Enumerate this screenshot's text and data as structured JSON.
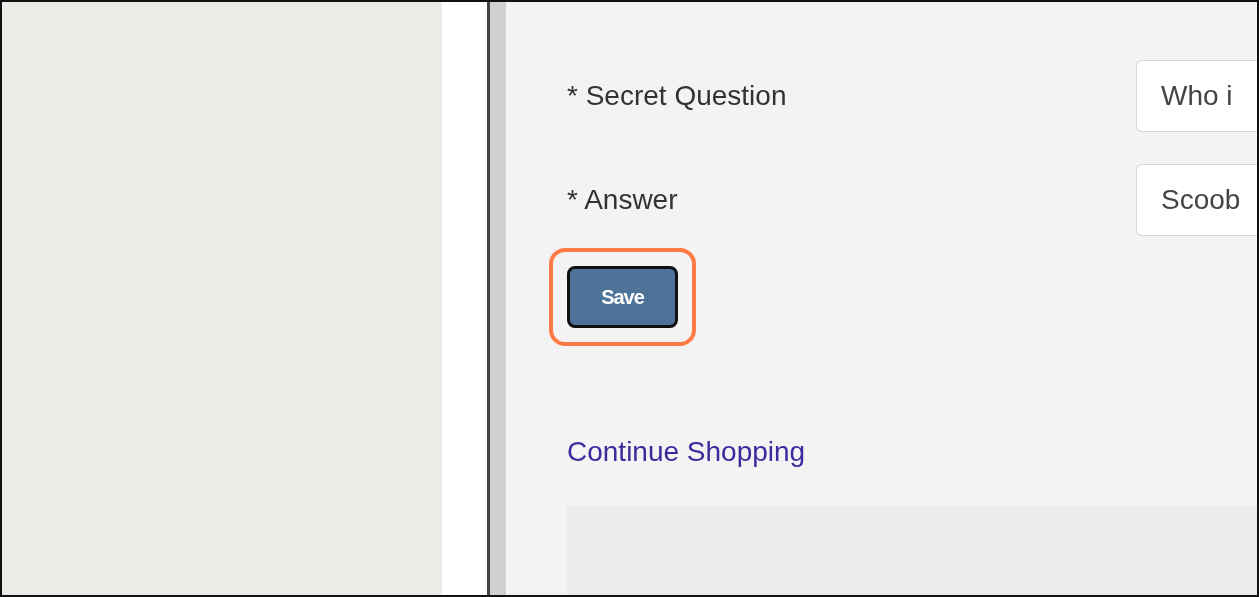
{
  "form": {
    "fields": [
      {
        "label": "* Secret Question",
        "value": "Who i"
      },
      {
        "label": "* Answer",
        "value": "Scoob"
      }
    ]
  },
  "save_button": {
    "label": "Save",
    "highlighted": true
  },
  "link": "Continue Shopping"
}
